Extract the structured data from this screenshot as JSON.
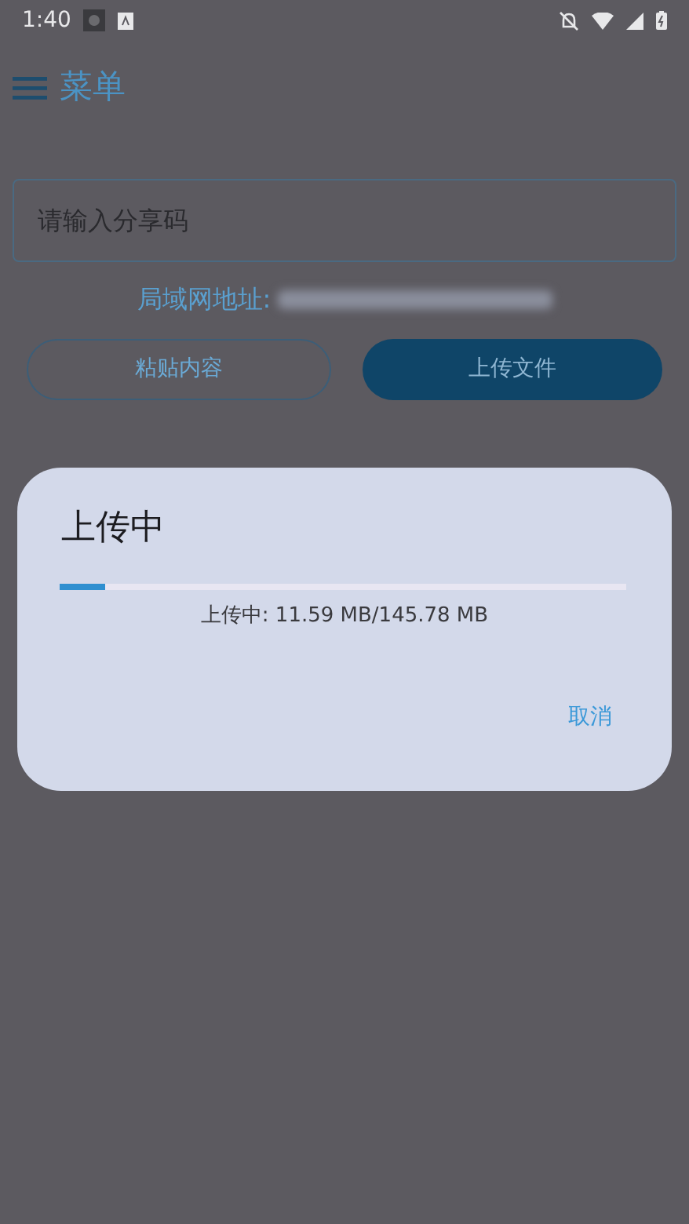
{
  "status_bar": {
    "time": "1:40"
  },
  "app_bar": {
    "title": "菜单"
  },
  "share_code_field": {
    "placeholder": "请输入分享码"
  },
  "lan_address": {
    "label": "局域网地址:"
  },
  "buttons": [
    {
      "label": "粘贴内容",
      "kind": "outline"
    },
    {
      "label": "上传文件",
      "kind": "filled"
    }
  ],
  "dialog": {
    "title": "上传中",
    "progress": {
      "level": 0.08
    },
    "status": "上传中: 11.59 MB/145.78 MB",
    "actions": [
      "取消"
    ]
  }
}
